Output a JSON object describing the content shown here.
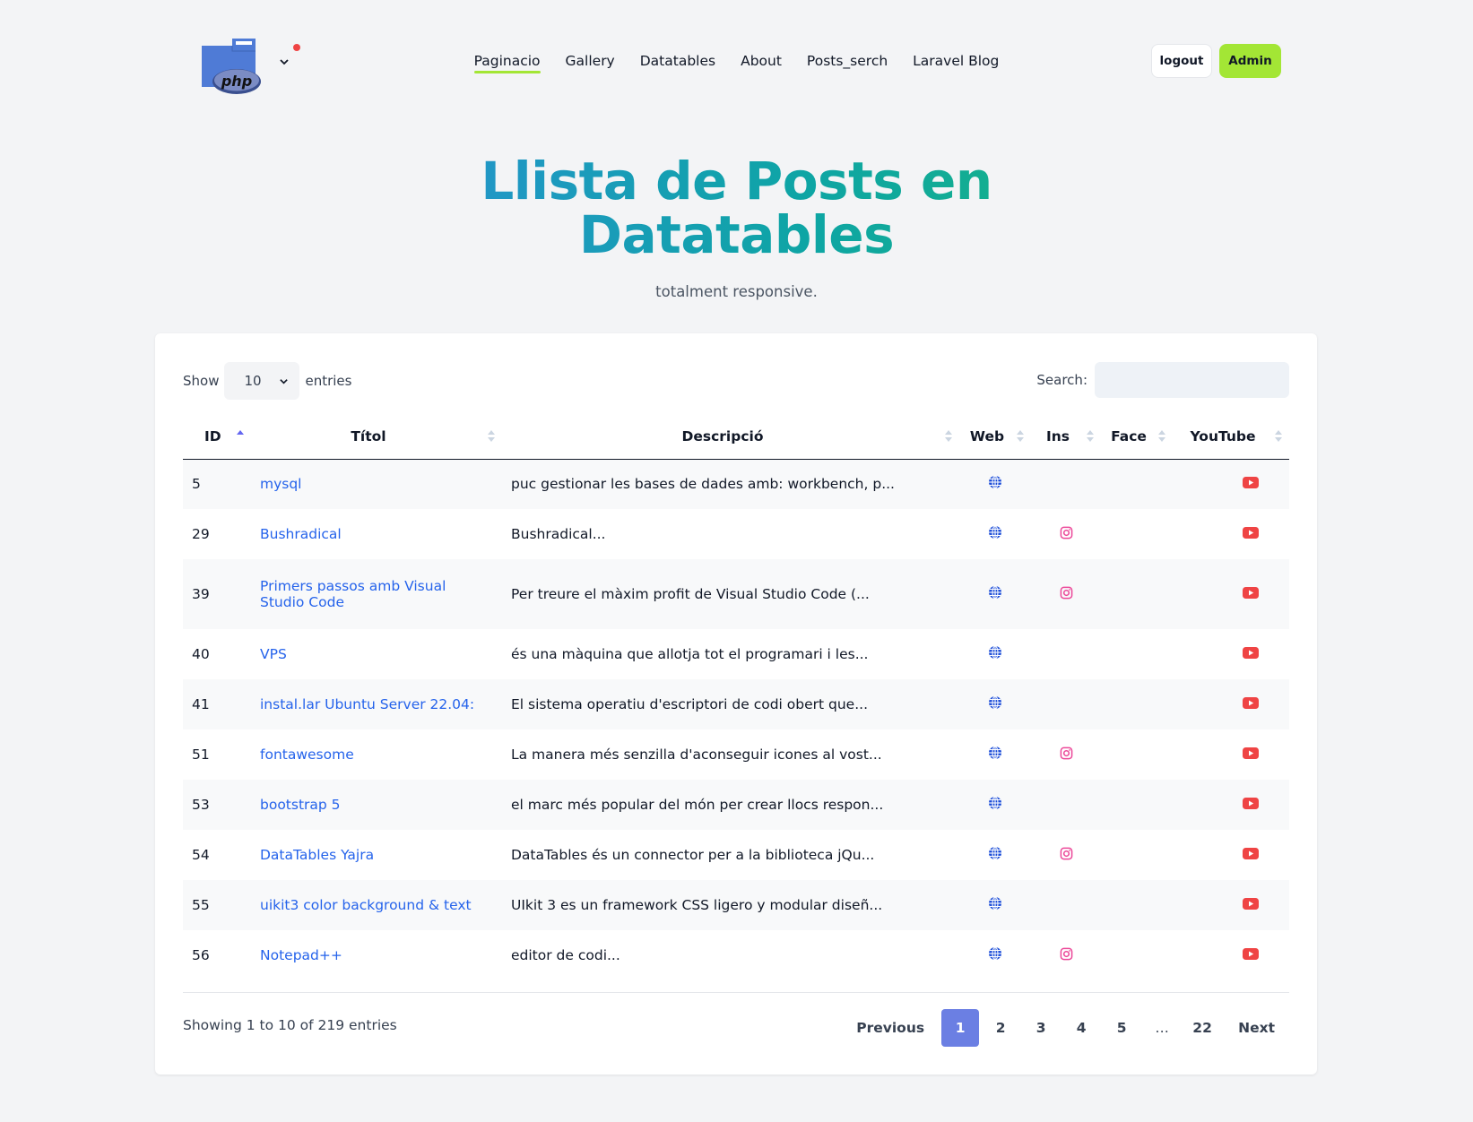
{
  "header": {
    "nav": [
      "Paginacio",
      "Gallery",
      "Datatables",
      "About",
      "Posts_serch",
      "Laravel Blog"
    ],
    "active_nav": "Paginacio",
    "logout_label": "logout",
    "admin_label": "Admin",
    "logo_text": "php",
    "accent_color": "#a3e635"
  },
  "hero": {
    "title_line1": "Llista de Posts en",
    "title_line2": "Datatables",
    "subtitle": "totalment responsive."
  },
  "table": {
    "show_label": "Show",
    "entries_label": "entries",
    "page_length": "10",
    "search_label": "Search:",
    "search_value": "",
    "columns": [
      "ID",
      "Títol",
      "Descripció",
      "Web",
      "Ins",
      "Face",
      "YouTube"
    ],
    "sorted_column": "ID",
    "sort_direction": "asc",
    "rows": [
      {
        "id": "5",
        "title": "mysql",
        "desc": "puc gestionar les bases de dades amb: workbench, p...",
        "web": true,
        "ins": false,
        "face": false,
        "yt": true
      },
      {
        "id": "29",
        "title": "Bushradical",
        "desc": "Bushradical...",
        "web": true,
        "ins": true,
        "face": false,
        "yt": true
      },
      {
        "id": "39",
        "title": "Primers passos amb Visual Studio Code",
        "desc": "Per treure el màxim profit de Visual Studio Code (...",
        "web": true,
        "ins": true,
        "face": false,
        "yt": true
      },
      {
        "id": "40",
        "title": "VPS",
        "desc": "és una màquina que allotja tot el programari i les...",
        "web": true,
        "ins": false,
        "face": false,
        "yt": true
      },
      {
        "id": "41",
        "title": "instal.lar Ubuntu Server 22.04:",
        "desc": "El sistema operatiu d'escriptori de codi obert que...",
        "web": true,
        "ins": false,
        "face": false,
        "yt": true
      },
      {
        "id": "51",
        "title": "fontawesome",
        "desc": "La manera més senzilla d'aconseguir icones al vost...",
        "web": true,
        "ins": true,
        "face": false,
        "yt": true
      },
      {
        "id": "53",
        "title": "bootstrap 5",
        "desc": "el marc més popular del món per crear llocs respon...",
        "web": true,
        "ins": false,
        "face": false,
        "yt": true
      },
      {
        "id": "54",
        "title": "DataTables Yajra",
        "desc": "DataTables és un connector per a la biblioteca jQu...",
        "web": true,
        "ins": true,
        "face": false,
        "yt": true
      },
      {
        "id": "55",
        "title": "uikit3 color background & text",
        "desc": "UIkit 3 es un framework CSS ligero y modular diseñ...",
        "web": true,
        "ins": false,
        "face": false,
        "yt": true
      },
      {
        "id": "56",
        "title": "Notepad++",
        "desc": "editor de codi...",
        "web": true,
        "ins": true,
        "face": false,
        "yt": true
      }
    ],
    "icon_names": {
      "web": "globe-icon",
      "ins": "instagram-icon",
      "yt": "youtube-icon"
    },
    "icon_colors": {
      "web": "#1d4ed8",
      "ins": "#ec4899",
      "yt": "#ef4444"
    }
  },
  "footer": {
    "info": "Showing 1 to 10 of 219 entries",
    "pagination": {
      "previous": "Previous",
      "next": "Next",
      "pages": [
        "1",
        "2",
        "3",
        "4",
        "5",
        "…",
        "22"
      ],
      "current": "1",
      "current_color": "#6b7fe3"
    }
  }
}
